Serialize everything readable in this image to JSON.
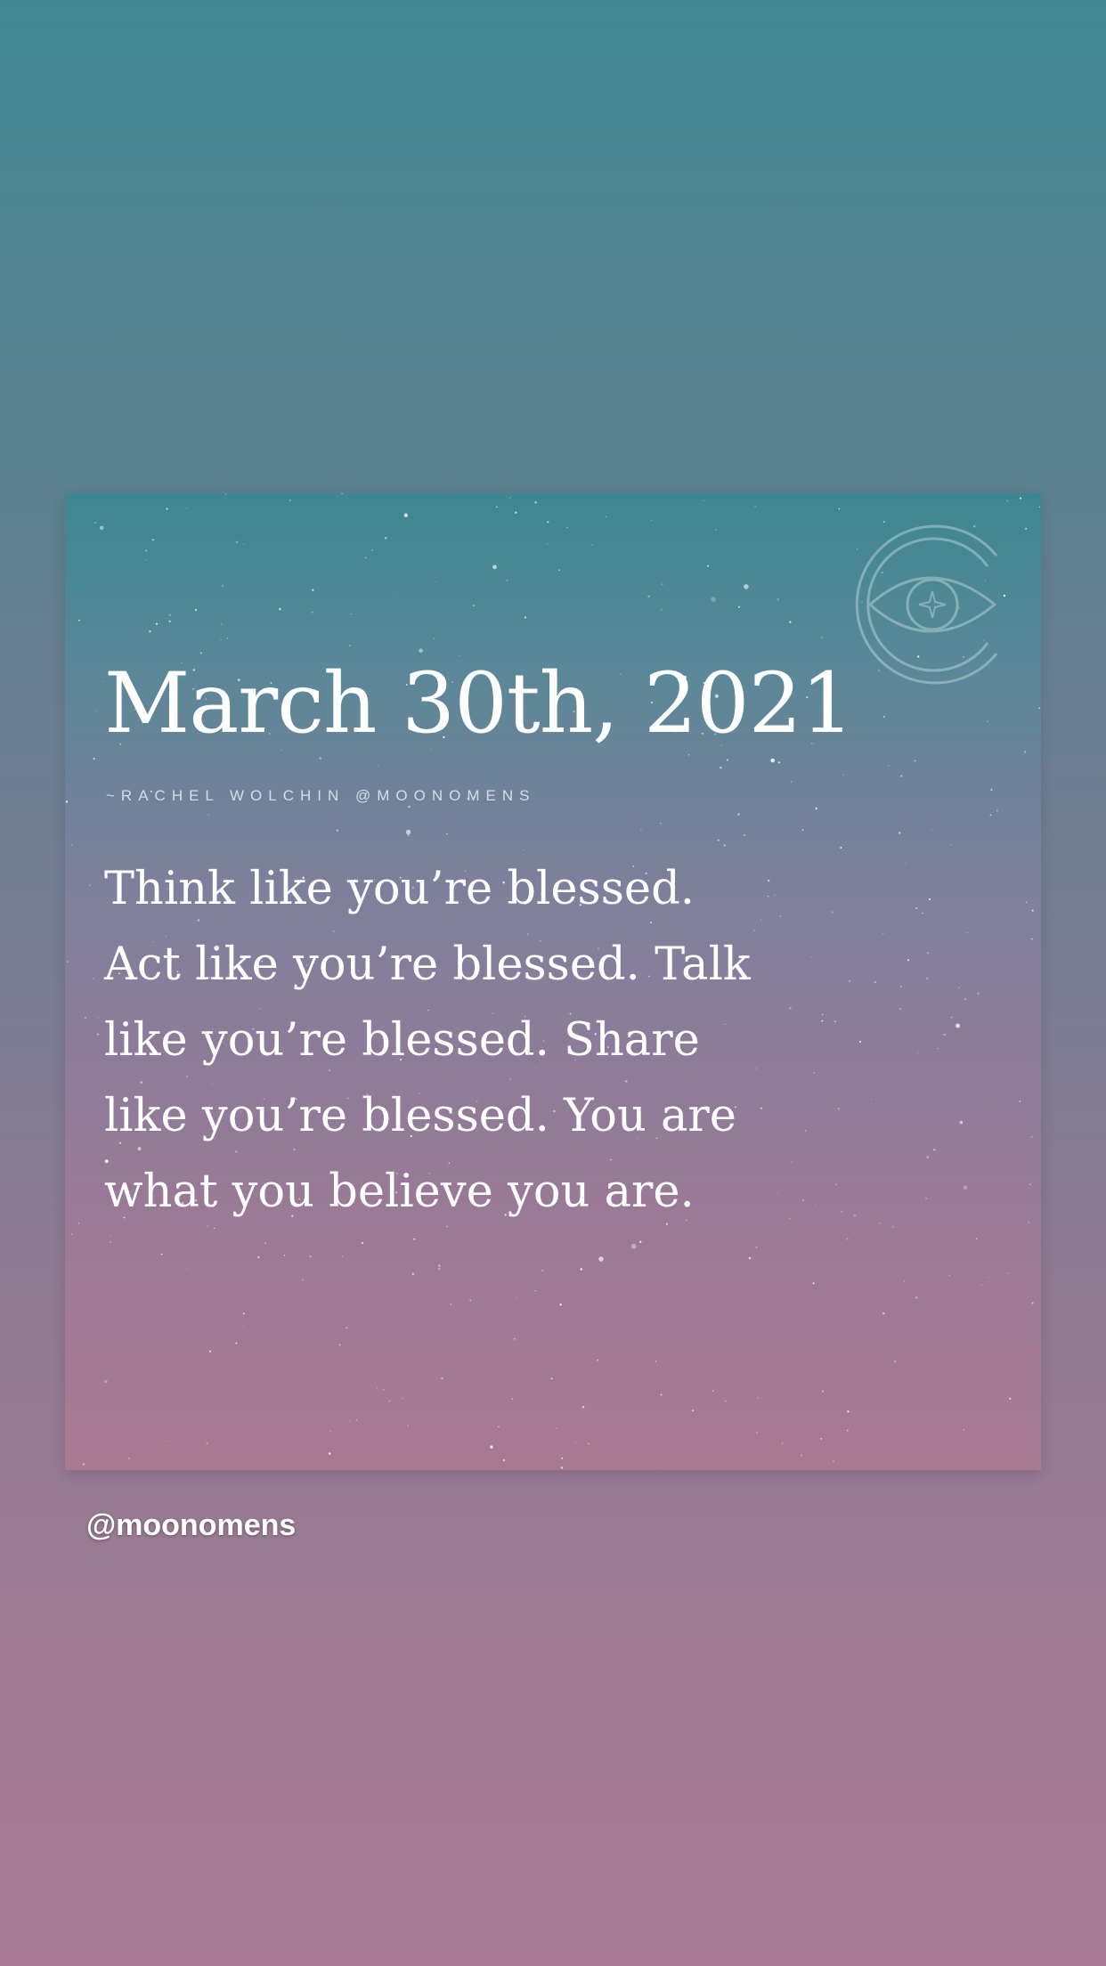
{
  "post": {
    "date": "March 30th, 2021",
    "credit": "~RACHEL WOLCHIN @MOONOMENS",
    "quote_lines": [
      "Think like you’re blessed.",
      "Act like you’re blessed. Talk",
      "like you’re blessed. Share",
      "like you’re blessed. You are",
      "what you believe you are."
    ],
    "logo_icon": "moon-eye-icon"
  },
  "story": {
    "username": "@moonomens"
  },
  "colors": {
    "background_top": "#3f8790",
    "background_bottom": "#a67b93",
    "text": "#ffffff"
  }
}
